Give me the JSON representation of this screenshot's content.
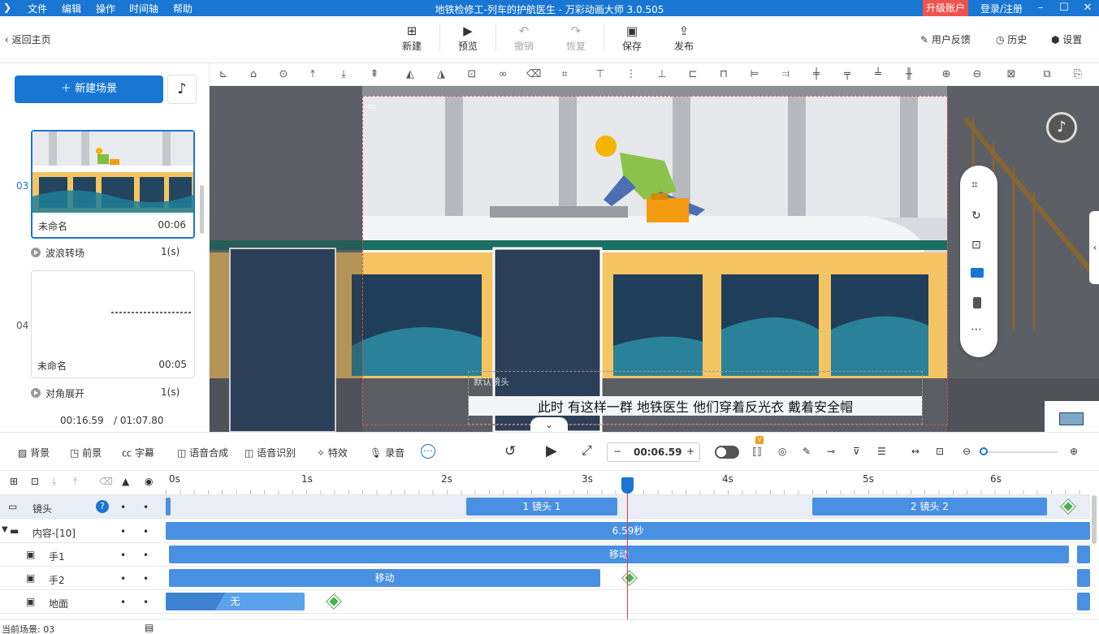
{
  "titlebar": {
    "menus": [
      "文件",
      "编辑",
      "操作",
      "时间轴",
      "帮助"
    ],
    "title": "地铁检修工-列车的护航医生 - 万彩动画大师 3.0.505",
    "upgrade": "升级账户",
    "login": "登录/注册"
  },
  "toolbar": {
    "back": "返回主页",
    "buttons": [
      "新建",
      "预览",
      "撤销",
      "恢复",
      "保存",
      "发布"
    ],
    "feedback": "用户反馈",
    "history": "历史",
    "settings": "设置"
  },
  "leftpanel": {
    "new_scene": "新建场景",
    "scenes": [
      {
        "num": "03",
        "name": "未命名",
        "duration": "00:06"
      },
      {
        "num": "04",
        "name": "未命名",
        "duration": "00:05"
      }
    ],
    "transitions": [
      {
        "name": "波浪转场",
        "duration": "1(s)"
      },
      {
        "name": "对角展开",
        "duration": "1(s)"
      }
    ],
    "current_time": "00:16.59",
    "total_time": "/ 01:07.80"
  },
  "canvas": {
    "subtitle": "此时 有这样一群  地铁医生  他们穿着反光衣  戴着安全帽",
    "subtitle_tag": "默认镜头"
  },
  "controls": {
    "left": [
      "背景",
      "前景",
      "字幕",
      "语音合成",
      "语音识别",
      "特效",
      "录音"
    ],
    "time": "00:06.59"
  },
  "timeline": {
    "ticks": [
      "0s",
      "1s",
      "2s",
      "3s",
      "4s",
      "5s",
      "6s"
    ],
    "tracks": [
      {
        "name": "镜头",
        "bars": [
          {
            "label": "1 镜头 1"
          },
          {
            "label": "2 镜头 2"
          }
        ]
      },
      {
        "name": "内容-[10]",
        "bars": [
          {
            "label": "6.59秒"
          }
        ]
      },
      {
        "name": "手1",
        "bars": [
          {
            "label": "移动"
          }
        ]
      },
      {
        "name": "手2",
        "bars": [
          {
            "label": "移动"
          }
        ]
      },
      {
        "name": "地面",
        "bars": [
          {
            "label": "无"
          }
        ]
      }
    ]
  },
  "status": {
    "current_scene": "当前场景: 03"
  },
  "colors": {
    "primary": "#1976d2",
    "bar": "#4a90e2",
    "keyframe": "#4caf50",
    "playhead": "#e53935",
    "upgrade": "#ef5350"
  }
}
